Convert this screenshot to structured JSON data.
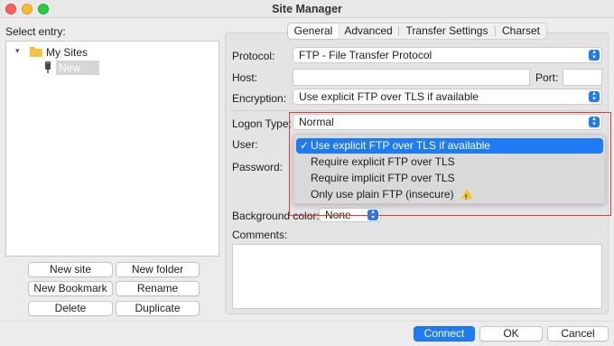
{
  "window": {
    "title": "Site Manager"
  },
  "left": {
    "select_entry_label": "Select entry:",
    "tree": {
      "root_label": "My Sites",
      "child_label": "New site"
    },
    "buttons": {
      "new_site": "New site",
      "new_folder": "New folder",
      "new_bookmark": "New Bookmark",
      "rename": "Rename",
      "delete": "Delete",
      "duplicate": "Duplicate"
    }
  },
  "tabs": [
    "General",
    "Advanced",
    "Transfer Settings",
    "Charset"
  ],
  "general": {
    "protocol_label": "Protocol:",
    "protocol_value": "FTP - File Transfer Protocol",
    "host_label": "Host:",
    "host_value": "",
    "port_label": "Port:",
    "port_value": "",
    "encryption_label": "Encryption:",
    "encryption_value": "Use explicit FTP over TLS if available",
    "logon_type_label": "Logon Type:",
    "logon_type_value": "Normal",
    "user_label": "User:",
    "password_label": "Password:",
    "background_color_label": "Background color:",
    "background_color_value": "None",
    "comments_label": "Comments:"
  },
  "encryption_dropdown": {
    "options": [
      "Use explicit FTP over TLS if available",
      "Require explicit FTP over TLS",
      "Require implicit FTP over TLS",
      "Only use plain FTP (insecure)"
    ],
    "selected_index": 0,
    "check_glyph": "✓"
  },
  "footer": {
    "connect": "Connect",
    "ok": "OK",
    "cancel": "Cancel"
  },
  "colors": {
    "accent": "#1e7bf3",
    "highlight_border": "#e0393e",
    "warning": "#f5c518"
  }
}
